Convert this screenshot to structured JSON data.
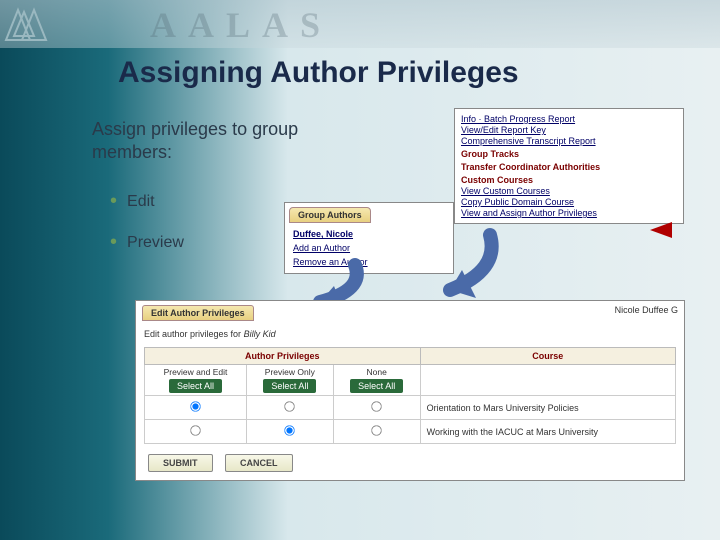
{
  "watermark": "AALAS",
  "title": "Assigning Author Privileges",
  "intro": "Assign privileges to group members:",
  "bullets": [
    "Edit",
    "Preview"
  ],
  "menu": {
    "links_top": [
      "Info · Batch Progress Report",
      "View/Edit Report Key",
      "Comprehensive Transcript Report"
    ],
    "headers": [
      "Group Tracks",
      "Transfer Coordinator Authorities",
      "Custom Courses"
    ],
    "links_custom": [
      "View Custom Courses",
      "Copy Public Domain Course",
      "View and Assign Author Privileges"
    ]
  },
  "authors_panel": {
    "tab": "Group Authors",
    "name": "Duffee, Nicole",
    "actions": [
      "Add an Author",
      "Remove an Author"
    ]
  },
  "edit_panel": {
    "tab": "Edit Author Privileges",
    "topright": "Nicole Duffee  G",
    "sub_prefix": "Edit author privileges for ",
    "sub_name": "Billy Kid",
    "header_priv": "Author Privileges",
    "header_course": "Course",
    "cols": [
      "Preview and Edit",
      "Preview Only",
      "None"
    ],
    "select_all": "Select All",
    "rows": [
      {
        "selected": 0,
        "course": "Orientation to Mars University Policies"
      },
      {
        "selected": 1,
        "course": "Working with the IACUC at Mars University"
      }
    ],
    "buttons": {
      "submit": "SUBMIT",
      "cancel": "CANCEL"
    }
  }
}
